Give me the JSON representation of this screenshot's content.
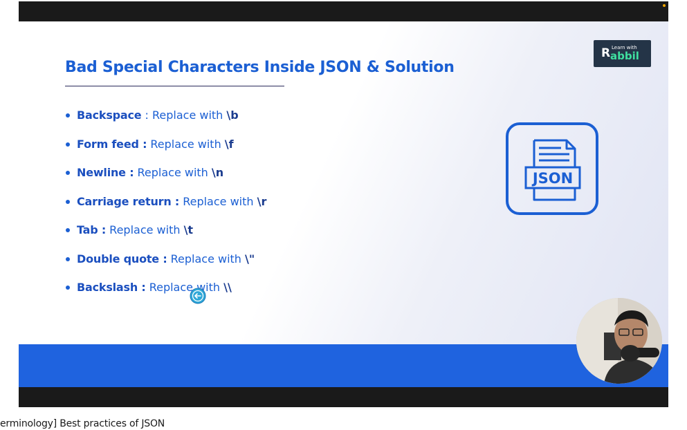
{
  "slide": {
    "title": "Bad Special Characters Inside JSON & Solution",
    "items": [
      {
        "term": "Backspace",
        "sep": " :  ",
        "action": "Replace with ",
        "code": "\\b"
      },
      {
        "term": "Form feed :",
        "sep": " ",
        "action": "Replace with  ",
        "code": "\\f"
      },
      {
        "term": "Newline :",
        "sep": " ",
        "action": "Replace with ",
        "code": "\\n"
      },
      {
        "term": "Carriage return :",
        "sep": " ",
        "action": "Replace with  ",
        "code": "\\r"
      },
      {
        "term": "Tab :",
        "sep": " ",
        "action": "Replace with ",
        "code": "\\t"
      },
      {
        "term": "Double quote :",
        "sep": " ",
        "action": "Replace with ",
        "code": "\\\""
      },
      {
        "term": "Backslash :",
        "sep": " ",
        "action": "Replace with ",
        "code": "\\\\"
      }
    ],
    "json_icon": {
      "label": "JSON",
      "icon": "json-file-icon"
    },
    "logo": {
      "small": "Learn with",
      "word": "abbil",
      "initial": "R"
    }
  },
  "caption": "erminology] Best practices of JSON",
  "colors": {
    "accent": "#1b5fd3",
    "band": "#1f63df",
    "logo_bg": "#243447",
    "logo_text": "#3fe0a0",
    "frame": "#1a1a1a"
  },
  "icons": {
    "cursor": "arrow-left-circle-icon",
    "recording": "recording-dot-icon",
    "webcam": "presenter-webcam"
  }
}
